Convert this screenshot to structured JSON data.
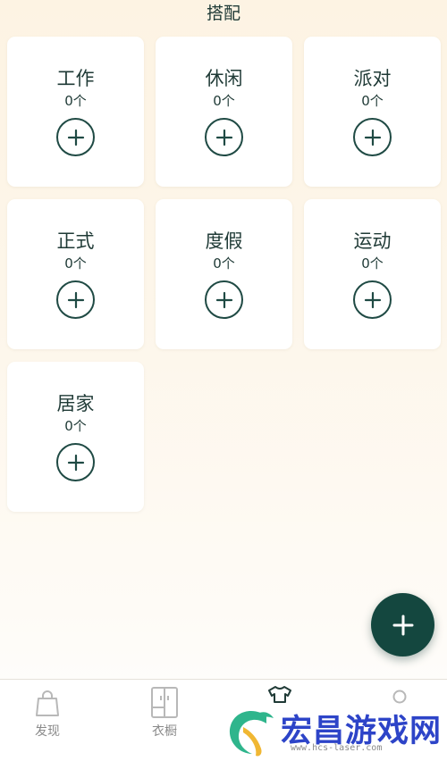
{
  "header": {
    "title": "搭配"
  },
  "categories": [
    {
      "name": "工作",
      "count": "0个"
    },
    {
      "name": "休闲",
      "count": "0个"
    },
    {
      "name": "派对",
      "count": "0个"
    },
    {
      "name": "正式",
      "count": "0个"
    },
    {
      "name": "度假",
      "count": "0个"
    },
    {
      "name": "运动",
      "count": "0个"
    },
    {
      "name": "居家",
      "count": "0个"
    }
  ],
  "fab": {
    "icon": "plus-icon"
  },
  "tabbar": {
    "tabs": [
      {
        "label": "发现",
        "icon": "shopping-bag-icon"
      },
      {
        "label": "衣橱",
        "icon": "wardrobe-icon"
      },
      {
        "label": "",
        "icon": "shirt-icon"
      },
      {
        "label": "",
        "icon": "profile-icon"
      }
    ]
  },
  "watermark": {
    "text": "宏昌游戏网",
    "url": "www.hcs-laser.com"
  },
  "colors": {
    "accent": "#14473f",
    "text": "#1f3a36",
    "watermark": "#2d44c8"
  }
}
